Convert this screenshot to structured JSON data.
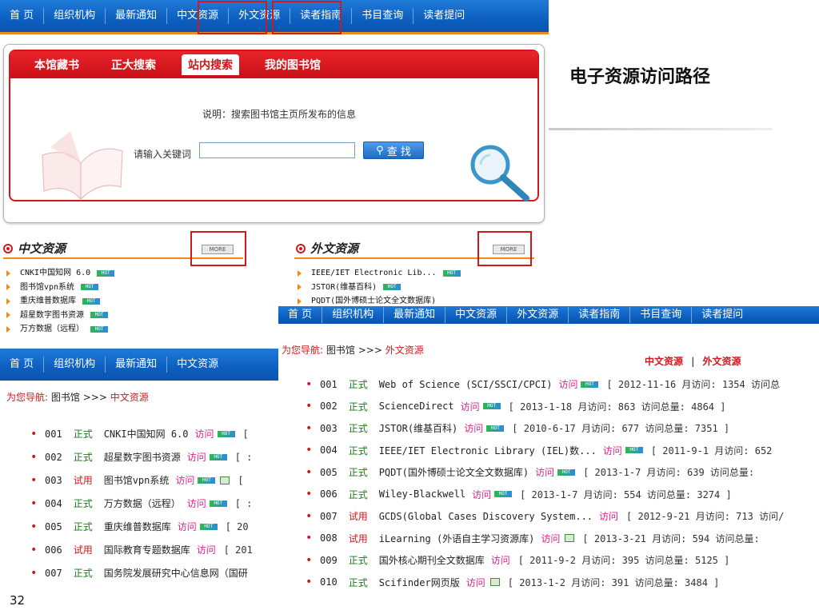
{
  "top_nav": {
    "items": [
      "首 页",
      "组织机构",
      "最新通知",
      "中文资源",
      "外文资源",
      "读者指南",
      "书目查询",
      "读者提问"
    ]
  },
  "library_box": {
    "tabs": [
      "本馆藏书",
      "正大搜索",
      "站内搜索",
      "我的图书馆"
    ],
    "note": "说明：搜索图书馆主页所发布的信息",
    "keyword_label": "请输入关键词",
    "keyword_value": "",
    "search_button": "查 找"
  },
  "heading": "电子资源访问路径",
  "chinese_section": {
    "title": "中文资源",
    "more": "MORE",
    "items": [
      "CNKI中国知网 6.0",
      "图书馆vpn系统",
      "重庆维普数据库",
      "超星数字图书资源",
      "万方数据（远程）"
    ]
  },
  "foreign_section": {
    "title": "外文资源",
    "more": "MORE",
    "items": [
      "IEEE/IET Electronic Lib...",
      "JSTOR(维基百科)",
      "PQDT(国外博硕士论文全文数据库)"
    ]
  },
  "hot_label": "HOT",
  "chinese_panel": {
    "nav": [
      "首 页",
      "组织机构",
      "最新通知",
      "中文资源"
    ],
    "crumb_prefix": "为您导航:",
    "crumb_lib": "图书馆",
    "crumb_sep": ">>>",
    "crumb_current": "中文资源",
    "rows": [
      {
        "no": "001",
        "status": "正式",
        "name": "CNKI中国知网 6.0",
        "visit": "访问",
        "tail": "["
      },
      {
        "no": "002",
        "status": "正式",
        "name": "超星数字图书资源",
        "visit": "访问",
        "tail": "[ :"
      },
      {
        "no": "003",
        "status": "试用",
        "name": "图书馆vpn系统",
        "visit": "访问",
        "tail": "["
      },
      {
        "no": "004",
        "status": "正式",
        "name": "万方数据（远程）",
        "visit": "访问",
        "tail": "[ :"
      },
      {
        "no": "005",
        "status": "正式",
        "name": "重庆维普数据库",
        "visit": "访问",
        "tail": "[ 20"
      },
      {
        "no": "006",
        "status": "试用",
        "name": "国际教育专题数据库",
        "visit": "访问",
        "tail": "[ 201"
      },
      {
        "no": "007",
        "status": "正式",
        "name": "国务院发展研究中心信息网（国研",
        "visit": "",
        "tail": ""
      }
    ]
  },
  "foreign_panel": {
    "nav": [
      "首 页",
      "组织机构",
      "最新通知",
      "中文资源",
      "外文资源",
      "读者指南",
      "书目查询",
      "读者提问"
    ],
    "crumb_prefix": "为您导航:",
    "crumb_lib": "图书馆",
    "crumb_sep": ">>>",
    "crumb_current": "外文资源",
    "switch_cn": "中文资源",
    "switch_sep": "|",
    "switch_en": "外文资源",
    "rows": [
      {
        "no": "001",
        "status": "正式",
        "name": "Web of Science (SCI/SSCI/CPCI)",
        "visit": "访问",
        "meta": "[ 2012-11-16  月访问: 1354  访问总"
      },
      {
        "no": "002",
        "status": "正式",
        "name": "ScienceDirect",
        "visit": "访问",
        "meta": "[ 2013-1-18  月访问: 863  访问总量: 4864 ]"
      },
      {
        "no": "003",
        "status": "正式",
        "name": "JSTOR(维基百科)",
        "visit": "访问",
        "meta": "[ 2010-6-17  月访问: 677  访问总量: 7351 ]"
      },
      {
        "no": "004",
        "status": "正式",
        "name": "IEEE/IET Electronic Library (IEL)数...",
        "visit": "访问",
        "meta": "[ 2011-9-1  月访问: 652"
      },
      {
        "no": "005",
        "status": "正式",
        "name": "PQDT(国外博硕士论文全文数据库)",
        "visit": "访问",
        "meta": "[ 2013-1-7  月访问: 639  访问总量:"
      },
      {
        "no": "006",
        "status": "正式",
        "name": "Wiley-Blackwell",
        "visit": "访问",
        "meta": "[ 2013-1-7  月访问: 554  访问总量: 3274 ]"
      },
      {
        "no": "007",
        "status": "试用",
        "name": "GCDS(Global Cases Discovery System...",
        "visit": "访问",
        "meta": "[ 2012-9-21  月访问: 713  访问/"
      },
      {
        "no": "008",
        "status": "试用",
        "name": "iLearning (外语自主学习资源库)",
        "visit": "访问",
        "meta": "[ 2013-3-21  月访问: 594  访问总量:"
      },
      {
        "no": "009",
        "status": "正式",
        "name": "国外核心期刊全文数据库",
        "visit": "访问",
        "meta": "[ 2011-9-2  月访问: 395  访问总量: 5125 ]"
      },
      {
        "no": "010",
        "status": "正式",
        "name": "Scifinder网页版",
        "visit": "访问",
        "meta": "[ 2013-1-2  月访问: 391  访问总量: 3484 ]"
      }
    ]
  },
  "slide_number": "32"
}
